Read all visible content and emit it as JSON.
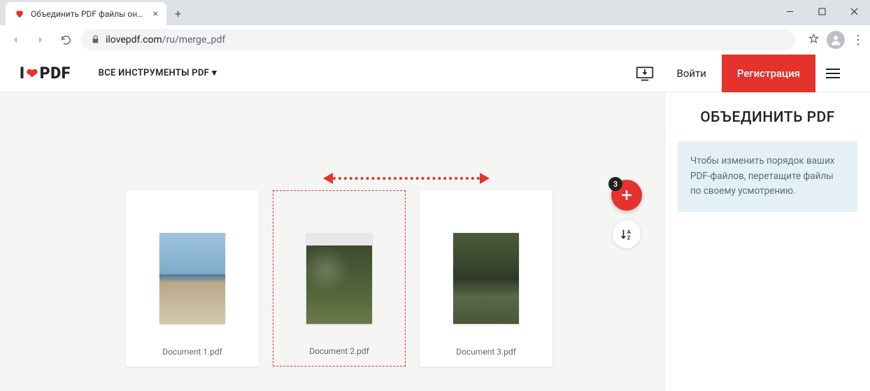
{
  "browser": {
    "tab_title": "Объединить PDF файлы онлайн",
    "url_domain": "ilovepdf.com",
    "url_path": "/ru/merge_pdf"
  },
  "header": {
    "logo_i": "I",
    "logo_pdf": "PDF",
    "tools_label": "ВСЕ ИНСТРУМЕНТЫ PDF",
    "login": "Войти",
    "register": "Регистрация"
  },
  "workspace": {
    "documents": [
      {
        "label": "Document 1.pdf"
      },
      {
        "label": "Document 2.pdf"
      },
      {
        "label": "Document 3.pdf"
      }
    ],
    "file_count": "3",
    "sort_label": "A↓Z"
  },
  "sidebar": {
    "title": "ОБЪЕДИНИТЬ PDF",
    "hint": "Чтобы изменить порядок ваших PDF-файлов, перетащите файлы по своему усмотрению."
  }
}
